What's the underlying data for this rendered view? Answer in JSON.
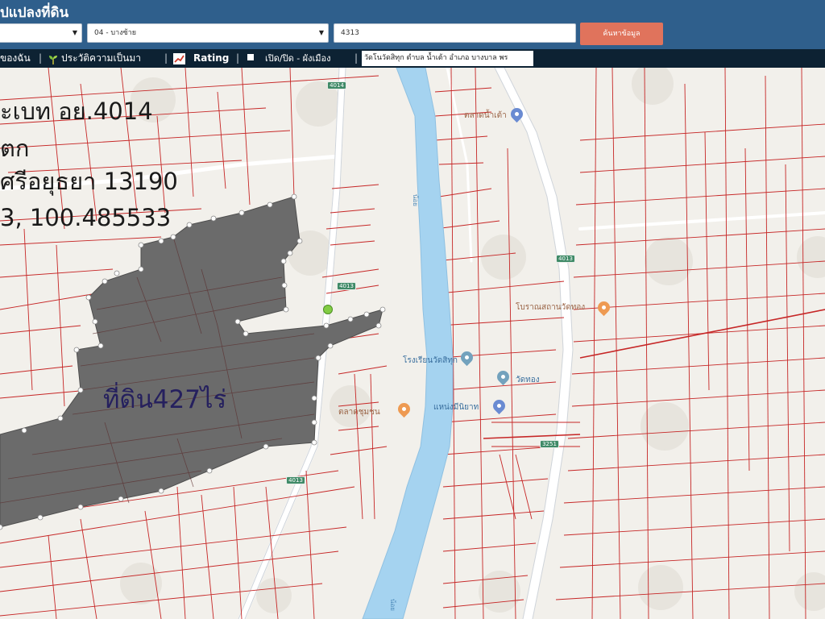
{
  "header": {
    "title": "ปแปลงที่ดิน",
    "province_select": "",
    "district_select": "04 - บางซ้าย",
    "parcel_input": "4313",
    "search_button": "ค้นหาข้อมูล"
  },
  "toolbar": {
    "item_favorite": "ของฉัน",
    "sep": "|",
    "item_history": "ประวัติความเป็นมา",
    "item_rating": "Rating",
    "item_zoning": "เปิด/ปิด - ผังเมือง",
    "location_field": "วัดโนวัดสิทุก ตำบล น้ำเต้า อำเภอ บางบาล พร"
  },
  "map": {
    "info_lines": [
      "ะเบท อย.4014",
      "ตก",
      "ศรีอยุธยา 13190",
      "3, 100.485533"
    ],
    "land_label": "ที่ดิน427ไร่",
    "road_badges": [
      "4014",
      "4013",
      "4013",
      "4013",
      "3251"
    ],
    "poi_labels": [
      "ตลาดน้ำเต้า",
      "โบราณสถานวัดทอง",
      "โรงเรียนวัดสิทุก",
      "วัดทอง",
      "แหน่งมีนิยาท",
      "ตลาดชุมชน"
    ],
    "river_labels": [
      "น้อย",
      "น้อย"
    ],
    "icons": [
      "location-pin-icon",
      "seedling-icon",
      "chart-icon",
      "checkbox-icon",
      "caret-down-icon"
    ]
  },
  "colors": {
    "header_bg": "#2f5f8c",
    "toolbar_bg": "#0d2233",
    "search_button_bg": "#e0735c",
    "parcel_line": "#c62626",
    "river": "#a5d3f0",
    "selected_land": "#6b6b6b",
    "road_badge": "#3f8a67"
  }
}
